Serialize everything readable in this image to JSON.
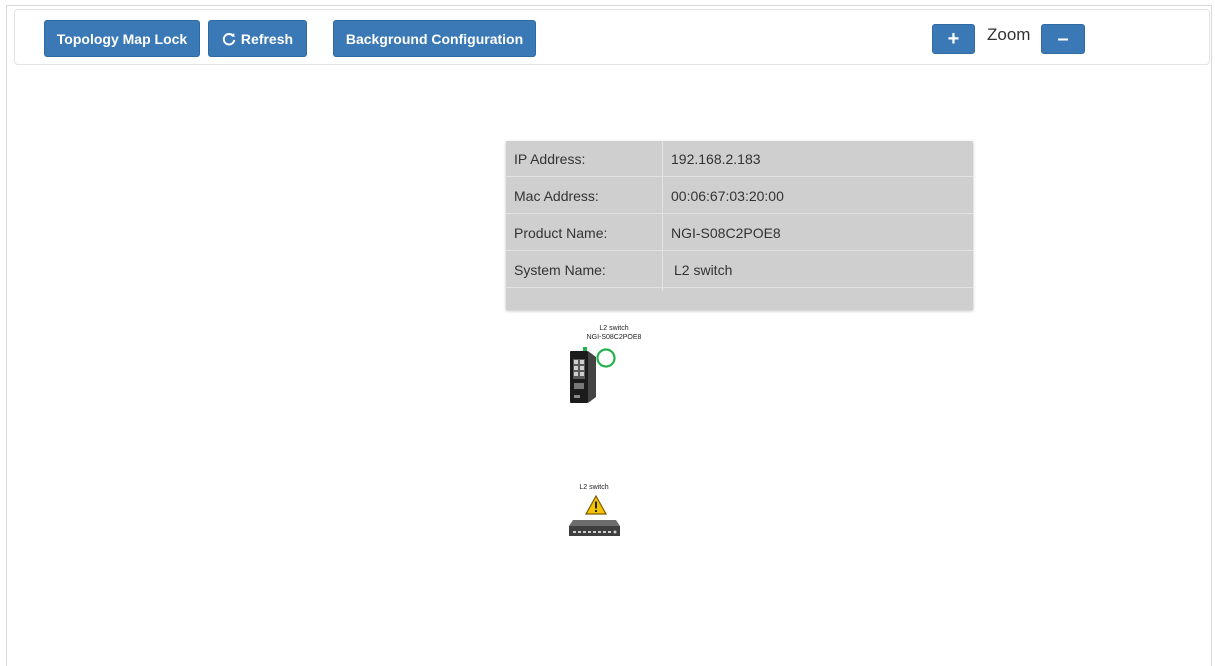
{
  "toolbar": {
    "lock_label": "Topology Map Lock",
    "refresh_label": "Refresh",
    "background_label": "Background Configuration",
    "zoom_in_label": "+",
    "zoom_label": "Zoom",
    "zoom_out_label": "–"
  },
  "info_panel": {
    "rows": [
      {
        "key": "IP Address:",
        "value": "192.168.2.183"
      },
      {
        "key": "Mac Address:",
        "value": "00:06:67:03:20:00"
      },
      {
        "key": "Product Name:",
        "value": "NGI-S08C2POE8"
      },
      {
        "key": "System Name:",
        "value": "L2 switch"
      }
    ]
  },
  "devices": [
    {
      "system_name": "L2 switch",
      "product_name": "NGI-S08C2POE8",
      "status": "online",
      "icon": "industrial-switch-icon"
    },
    {
      "system_name": "L2 switch",
      "status": "warning",
      "icon": "desktop-switch-icon"
    }
  ],
  "colors": {
    "button": "#3a79b6",
    "panel": "#cfcfcf",
    "online": "#22b24c",
    "warning": "#f5c400"
  }
}
